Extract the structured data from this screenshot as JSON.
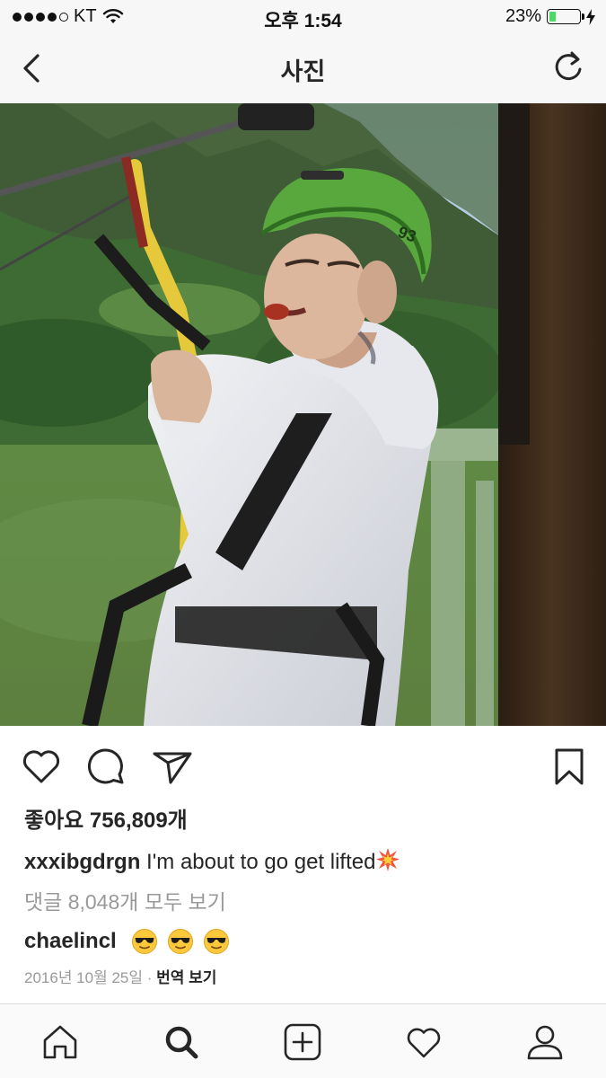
{
  "status_bar": {
    "carrier": "KT",
    "time": "오후 1:54",
    "battery": "23%",
    "battery_level": 0.23,
    "icons": [
      "signal-dots-icon",
      "wifi-icon",
      "battery-icon",
      "charging-bolt-icon"
    ]
  },
  "nav": {
    "title": "사진",
    "icons": [
      "back-chevron-icon",
      "refresh-icon"
    ]
  },
  "post": {
    "actions": [
      "heart-icon",
      "comment-icon",
      "send-icon",
      "bookmark-icon"
    ],
    "likes": "좋아요 756,809개",
    "caption": {
      "username": "xxxibgdrgn",
      "text": "I'm about to go get lifted",
      "emoji": "collision-emoji-icon"
    },
    "view_comments": "댓글 8,048개 모두 보기",
    "comment": {
      "username": "chaelincl",
      "emojis": [
        "sunglasses-face-emoji",
        "sunglasses-face-emoji",
        "sunglasses-face-emoji"
      ]
    },
    "date": "2016년 10월 25일",
    "separator": "·",
    "translate": "번역 보기"
  },
  "tab_bar": {
    "icons": [
      "home-icon",
      "search-icon",
      "add-post-icon",
      "activity-heart-icon",
      "profile-icon"
    ],
    "active": "search-icon"
  },
  "colors": {
    "text": "#262626",
    "muted": "#999999",
    "bar_bg": "#f7f7f7",
    "battery_green": "#4cd964",
    "divider": "#dbdbdb"
  }
}
